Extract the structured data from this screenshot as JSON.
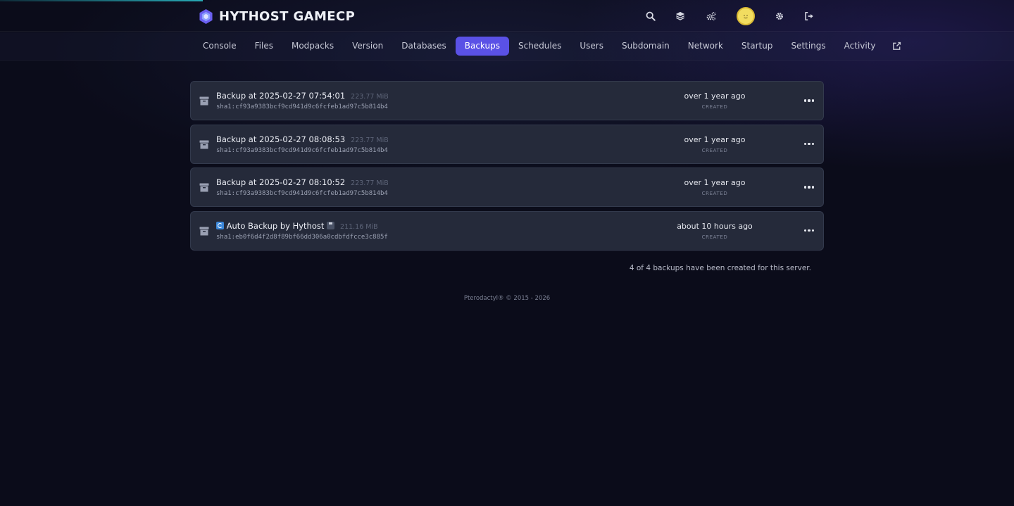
{
  "header": {
    "title": "HYTHOST GAMECP",
    "icons": [
      "search-icon",
      "layers-icon",
      "cogs-icon",
      "avatar",
      "settings-icon",
      "logout-icon"
    ]
  },
  "nav": {
    "tabs": [
      {
        "label": "Console",
        "active": false
      },
      {
        "label": "Files",
        "active": false
      },
      {
        "label": "Modpacks",
        "active": false
      },
      {
        "label": "Version",
        "active": false
      },
      {
        "label": "Databases",
        "active": false
      },
      {
        "label": "Backups",
        "active": true
      },
      {
        "label": "Schedules",
        "active": false
      },
      {
        "label": "Users",
        "active": false
      },
      {
        "label": "Subdomain",
        "active": false
      },
      {
        "label": "Network",
        "active": false
      },
      {
        "label": "Startup",
        "active": false
      },
      {
        "label": "Settings",
        "active": false
      },
      {
        "label": "Activity",
        "active": false
      }
    ],
    "external_icon": "external-link-icon"
  },
  "backups": [
    {
      "name": "Backup at 2025-02-27 07:54:01",
      "size": "223.77 MiB",
      "hash": "sha1:cf93a9383bcf9cd941d9c6fcfeb1ad97c5b814b4",
      "time": "over 1 year ago",
      "created_label": "CREATED"
    },
    {
      "name": "Backup at 2025-02-27 08:08:53",
      "size": "223.77 MiB",
      "hash": "sha1:cf93a9383bcf9cd941d9c6fcfeb1ad97c5b814b4",
      "time": "over 1 year ago",
      "created_label": "CREATED"
    },
    {
      "name": "Backup at 2025-02-27 08:10:52",
      "size": "223.77 MiB",
      "hash": "sha1:cf93a9383bcf9cd941d9c6fcfeb1ad97c5b814b4",
      "time": "over 1 year ago",
      "created_label": "CREATED"
    },
    {
      "name": "Auto Backup by Hythost",
      "size": "211.16 MiB",
      "hash": "sha1:eb0f6d4f2d8f89bf66dd306a0cdbfdfcce3c885f",
      "time": "about 10 hours ago",
      "created_label": "CREATED"
    }
  ],
  "summary": "4 of 4 backups have been created for this server.",
  "footer": "Pterodactyl® © 2015 - 2026",
  "colors": {
    "background": "#0b0c1a",
    "accent": "#5a51e6",
    "row_bg": "#252a3a",
    "avatar": "#f2dd60"
  }
}
